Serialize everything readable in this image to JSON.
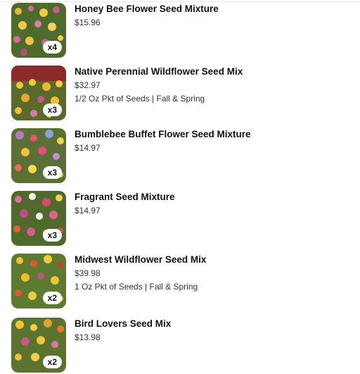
{
  "cart": {
    "items": [
      {
        "title": "Honey Bee Flower Seed Mixture",
        "price": "$15.96",
        "quantity_badge": "x4",
        "detail": ""
      },
      {
        "title": "Native Perennial Wildflower Seed Mix",
        "price": "$32.97",
        "quantity_badge": "x3",
        "detail": "1/2 Oz Pkt of Seeds | Fall & Spring"
      },
      {
        "title": "Bumblebee Buffet Flower Seed Mixture",
        "price": "$14.97",
        "quantity_badge": "x3",
        "detail": ""
      },
      {
        "title": "Fragrant Seed Mixture",
        "price": "$14.97",
        "quantity_badge": "x3",
        "detail": ""
      },
      {
        "title": "Midwest Wildflower Seed Mix",
        "price": "$39.98",
        "quantity_badge": "x2",
        "detail": "1 Oz Pkt of Seeds | Fall & Spring"
      },
      {
        "title": "Bird Lovers Seed Mix",
        "price": "$13.98",
        "quantity_badge": "x2",
        "detail": ""
      }
    ]
  }
}
